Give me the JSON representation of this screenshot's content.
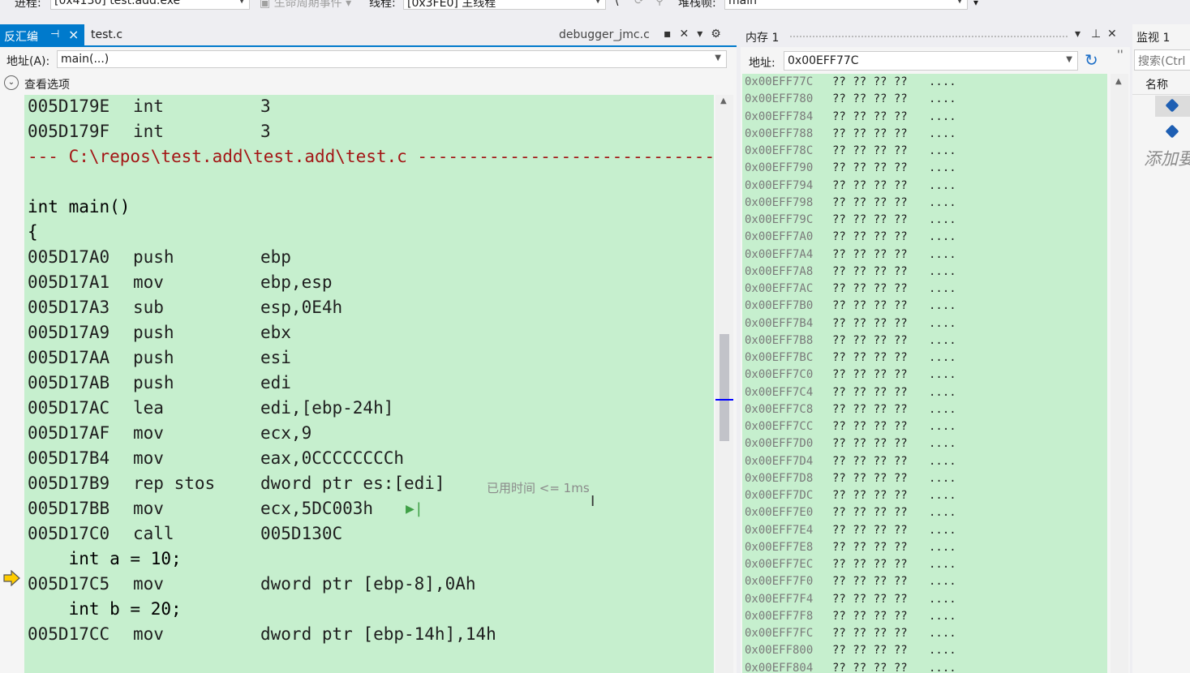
{
  "toolbar": {
    "process_label": "进程:",
    "process_value": "[0x4130] test.add.exe",
    "lifecycle_label": "生命周期事件",
    "thread_label": "线程:",
    "thread_value": "[0x3FE0] 主线程",
    "stackframe_label": "堆栈帧:",
    "stackframe_value": "main"
  },
  "disasm": {
    "tab_active": "反汇编",
    "tab_testc": "test.c",
    "tab_jmc": "debugger_jmc.c",
    "address_label": "地址(A):",
    "address_value": "main(...)",
    "view_options": "查看选项",
    "elapsed": "已用时间 <= 1ms",
    "lines": [
      {
        "type": "asm",
        "addr": "005D179E",
        "mnem": "int",
        "ops": "3"
      },
      {
        "type": "asm",
        "addr": "005D179F",
        "mnem": "int",
        "ops": "3"
      },
      {
        "type": "file",
        "text": "--- C:\\repos\\test.add\\test.add\\test.c ------------------------------------------------"
      },
      {
        "type": "blank",
        "text": ""
      },
      {
        "type": "src",
        "text": "int main()"
      },
      {
        "type": "src",
        "text": "{"
      },
      {
        "type": "asm",
        "addr": "005D17A0",
        "mnem": "push",
        "ops": "ebp"
      },
      {
        "type": "asm",
        "addr": "005D17A1",
        "mnem": "mov",
        "ops": "ebp,esp"
      },
      {
        "type": "asm",
        "addr": "005D17A3",
        "mnem": "sub",
        "ops": "esp,0E4h"
      },
      {
        "type": "asm",
        "addr": "005D17A9",
        "mnem": "push",
        "ops": "ebx"
      },
      {
        "type": "asm",
        "addr": "005D17AA",
        "mnem": "push",
        "ops": "esi"
      },
      {
        "type": "asm",
        "addr": "005D17AB",
        "mnem": "push",
        "ops": "edi"
      },
      {
        "type": "asm",
        "addr": "005D17AC",
        "mnem": "lea",
        "ops": "edi,[ebp-24h]"
      },
      {
        "type": "asm",
        "addr": "005D17AF",
        "mnem": "mov",
        "ops": "ecx,9"
      },
      {
        "type": "asm",
        "addr": "005D17B4",
        "mnem": "mov",
        "ops": "eax,0CCCCCCCCh"
      },
      {
        "type": "asm",
        "addr": "005D17B9",
        "mnem": "rep stos",
        "ops": "dword ptr es:[edi]",
        "current": true
      },
      {
        "type": "asm",
        "addr": "005D17BB",
        "mnem": "mov",
        "ops": "ecx,5DC003h",
        "runto": true
      },
      {
        "type": "asm",
        "addr": "005D17C0",
        "mnem": "call",
        "ops": "005D130C"
      },
      {
        "type": "src",
        "text": "    int a = 10;"
      },
      {
        "type": "asm",
        "addr": "005D17C5",
        "mnem": "mov",
        "ops": "dword ptr [ebp-8],0Ah"
      },
      {
        "type": "src",
        "text": "    int b = 20;"
      },
      {
        "type": "asm",
        "addr": "005D17CC",
        "mnem": "mov",
        "ops": "dword ptr [ebp-14h],14h"
      }
    ]
  },
  "memory": {
    "title": "内存 1",
    "address_label": "地址:",
    "address_value": "0x00EFF77C",
    "bytes": "?? ?? ?? ??",
    "ascii": "....",
    "rows": [
      "0x00EFF77C",
      "0x00EFF780",
      "0x00EFF784",
      "0x00EFF788",
      "0x00EFF78C",
      "0x00EFF790",
      "0x00EFF794",
      "0x00EFF798",
      "0x00EFF79C",
      "0x00EFF7A0",
      "0x00EFF7A4",
      "0x00EFF7A8",
      "0x00EFF7AC",
      "0x00EFF7B0",
      "0x00EFF7B4",
      "0x00EFF7B8",
      "0x00EFF7BC",
      "0x00EFF7C0",
      "0x00EFF7C4",
      "0x00EFF7C8",
      "0x00EFF7CC",
      "0x00EFF7D0",
      "0x00EFF7D4",
      "0x00EFF7D8",
      "0x00EFF7DC",
      "0x00EFF7E0",
      "0x00EFF7E4",
      "0x00EFF7E8",
      "0x00EFF7EC",
      "0x00EFF7F0",
      "0x00EFF7F4",
      "0x00EFF7F8",
      "0x00EFF7FC",
      "0x00EFF800",
      "0x00EFF804"
    ]
  },
  "watch": {
    "title": "监视 1",
    "search_placeholder": "搜索(Ctrl",
    "name_header": "名称",
    "add_item": "添加要"
  }
}
